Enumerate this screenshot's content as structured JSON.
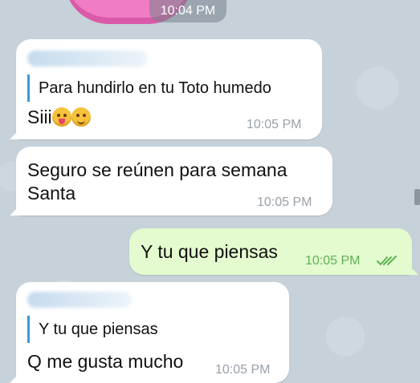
{
  "top": {
    "time_pill": "10:04 PM"
  },
  "messages": [
    {
      "direction": "incoming",
      "reply_quote": "Para hundirlo en tu Toto humedo",
      "text": "Siii",
      "emojis": [
        "zany-face-emoji",
        "drooling-face-emoji"
      ],
      "time": "10:05 PM"
    },
    {
      "direction": "incoming",
      "text_line1": "Seguro se reúnen para semana",
      "text_line2": "Santa",
      "time": "10:05 PM"
    },
    {
      "direction": "outgoing",
      "text": "Y tu que piensas",
      "time": "10:05 PM",
      "status_icon": "double-check-read-icon"
    },
    {
      "direction": "incoming",
      "reply_quote": "Y tu que piensas",
      "text": "Q me gusta mucho",
      "time": "10:05 PM"
    }
  ],
  "colors": {
    "wallpaper": "#c6d1d9",
    "incoming_bubble": "#ffffff",
    "outgoing_bubble": "#e3fbce",
    "reply_bar": "#3f97d9",
    "outgoing_time": "#5fb255",
    "incoming_time": "#9aa1a8"
  }
}
